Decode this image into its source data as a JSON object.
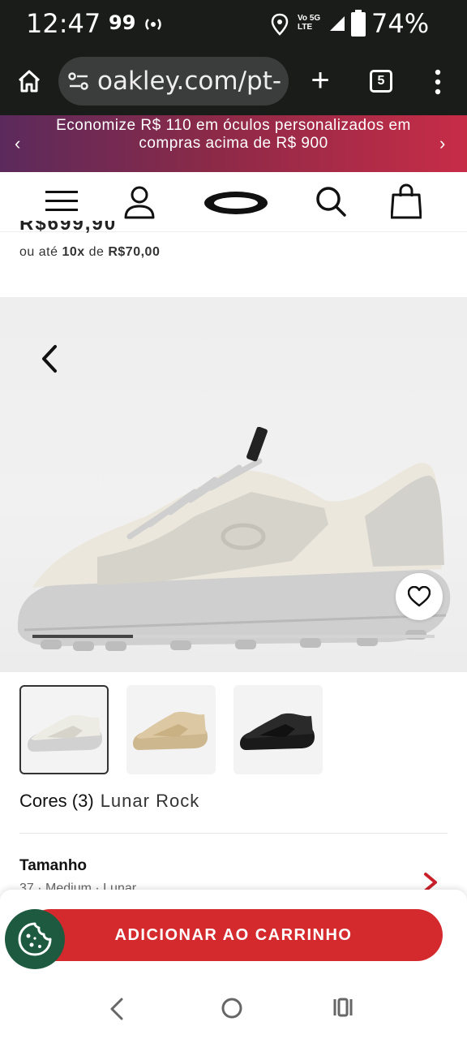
{
  "status_bar": {
    "time": "12:47",
    "notification": "99",
    "network": [
      "Vo",
      "LTE",
      "5G"
    ],
    "battery": "74%"
  },
  "browser": {
    "url": "oakley.com/pt-",
    "tab_count": "5"
  },
  "promo": {
    "text": "Economize R$ 110 em óculos personalizados em compras acima de R$ 900"
  },
  "product": {
    "price": "R$699,90",
    "installments_prefix": "ou até",
    "installments_count": "10x",
    "installments_mid": "de",
    "installment_value": "R$70,00",
    "gallery_progress": 0.25,
    "colors_label": "Cores (3)",
    "color_selected": "Lunar Rock",
    "size_label": "Tamanho",
    "size_hint": "37 · Medium · Lunar",
    "thumbnails": [
      "Lunar Rock",
      "Sand",
      "Black"
    ]
  },
  "actions": {
    "add_to_cart": "ADICIONAR AO CARRINHO"
  },
  "icons": [
    "home-icon",
    "tune-icon",
    "plus-icon",
    "tabs-icon",
    "more-vert-icon",
    "hamburger-menu-icon",
    "user-icon",
    "oakley-logo",
    "search-icon",
    "bag-icon",
    "chevron-left-icon",
    "heart-icon",
    "chevron-right-icon",
    "cookie-icon"
  ],
  "colors": {
    "cart_button": "#d42a2e",
    "promo_start": "#5b2a5c",
    "promo_end": "#c72c47",
    "cookie_button": "#1e5a3f"
  }
}
